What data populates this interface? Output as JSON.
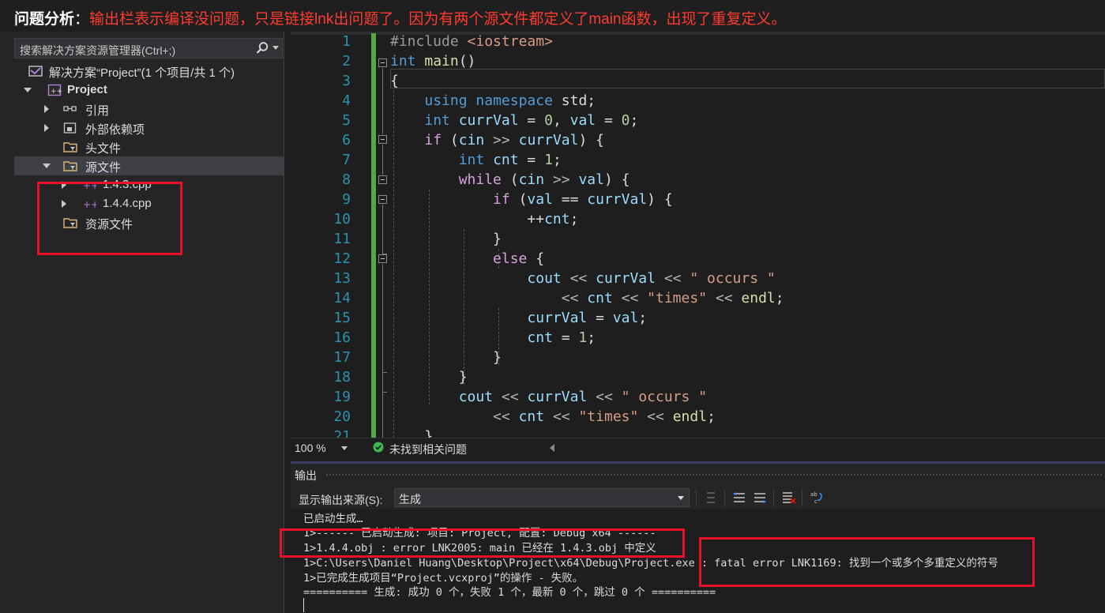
{
  "annotation": {
    "label": "问题分析",
    "colon": "：",
    "text": "输出栏表示编译没问题，只是链接lnk出问题了。因为有两个源文件都定义了main函数，出现了重复定义。"
  },
  "solution_explorer": {
    "search_placeholder": "搜索解决方案资源管理器(Ctrl+;)",
    "solution_label": "解决方案“Project”(1 个项目/共 1 个)",
    "project_label": "Project",
    "references_label": "引用",
    "external_deps_label": "外部依赖项",
    "header_files_label": "头文件",
    "source_files_label": "源文件",
    "file1_label": "1.4.3.cpp",
    "file2_label": "1.4.4.cpp",
    "resource_files_label": "资源文件"
  },
  "editor": {
    "line_numbers": [
      "1",
      "2",
      "3",
      "4",
      "5",
      "6",
      "7",
      "8",
      "9",
      "10",
      "11",
      "12",
      "13",
      "14",
      "15",
      "16",
      "17",
      "18",
      "19",
      "20",
      "21"
    ],
    "zoom": "100 %",
    "issues_status": "未找到相关问题"
  },
  "output_panel": {
    "title": "输出",
    "source_label": "显示输出来源(S):",
    "source_value": "生成",
    "lines": [
      "已启动生成…",
      "1>------ 已启动生成: 项目: Project, 配置: Debug x64 ------",
      "1>1.4.4.obj : error LNK2005: main 已经在 1.4.3.obj 中定义",
      "1>C:\\Users\\Daniel Huang\\Desktop\\Project\\x64\\Debug\\Project.exe : fatal error LNK1169: 找到一个或多个多重定义的符号",
      "1>已完成生成项目“Project.vcxproj”的操作 - 失败。",
      "========== 生成: 成功 0 个，失败 1 个，最新 0 个，跳过 0 个 =========="
    ]
  },
  "colors": {
    "annotation_red": "#ff3b30",
    "highlight_box": "#e8102a",
    "change_bar_green": "#57a64a",
    "editor_bg": "#1e1e1e"
  }
}
